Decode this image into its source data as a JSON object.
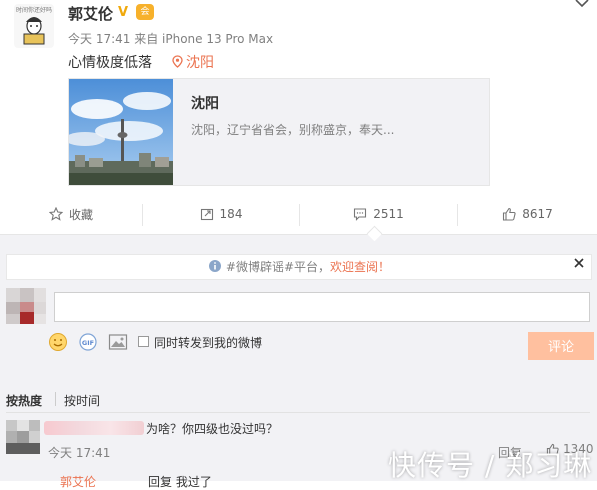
{
  "post": {
    "avatar_caption": "时间你还好吗",
    "author": "郭艾伦",
    "verified_badge": "V",
    "member_badge": "会",
    "meta": "今天 17:41 来自 iPhone 13 Pro Max",
    "text": "心情极度低落",
    "location_tag": "沈阳",
    "card": {
      "title": "沈阳",
      "description": "沈阳，辽宁省省会，别称盛京，奉天..."
    }
  },
  "actions": {
    "favorite": "收藏",
    "repost": "184",
    "comment": "2511",
    "like": "8617"
  },
  "comments": {
    "notice_prefix": "#微博辟谣#平台，",
    "notice_link": "欢迎查阅！",
    "input_value": "",
    "also_repost": "同时转发到我的微博",
    "submit": "评论",
    "sort_hot": "按热度",
    "sort_time": "按时间",
    "items": [
      {
        "text": "为啥？你四级也没过吗？",
        "time": "今天 17:41",
        "reply": "回复",
        "likes": "1340"
      }
    ],
    "second": {
      "name": "郭艾伦",
      "text": "回复 我过了"
    }
  },
  "watermark": "快传号 / 郑习琳",
  "colors": {
    "accent": "#eb7350",
    "panel": "#f2f2f5",
    "submit": "#ffc09f"
  }
}
